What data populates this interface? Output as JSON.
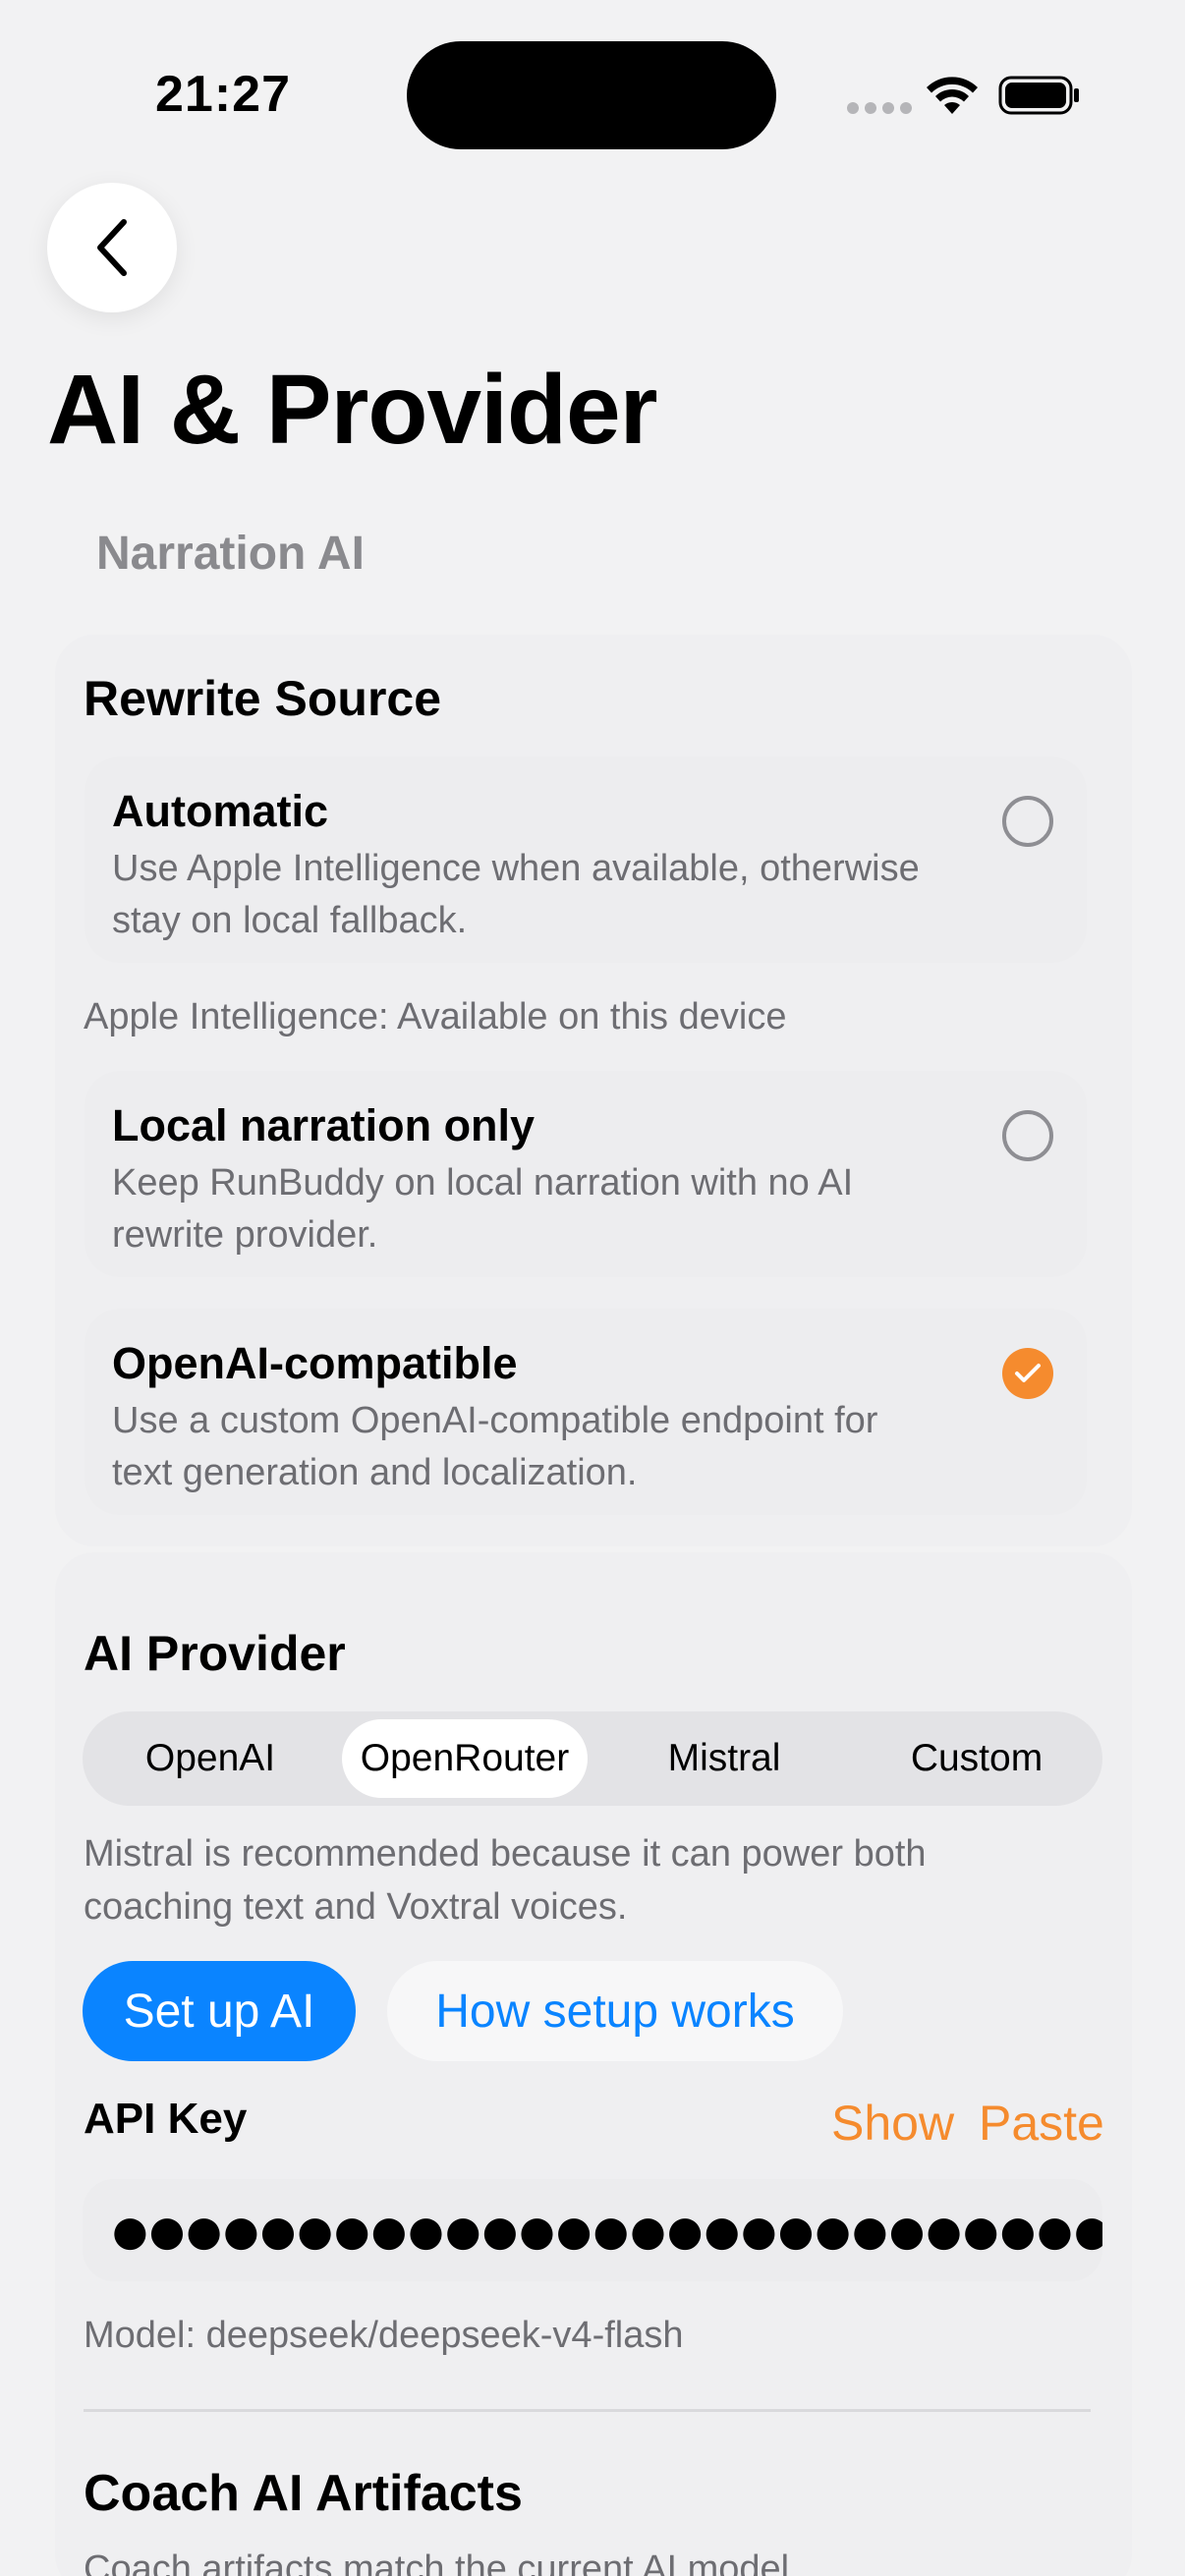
{
  "status_bar": {
    "time": "21:27"
  },
  "header": {
    "title": "AI & Provider",
    "section": "Narration AI"
  },
  "rewrite_source": {
    "title": "Rewrite Source",
    "options": [
      {
        "title": "Automatic",
        "description": "Use Apple Intelligence when available, otherwise stay on local fallback.",
        "selected": false
      },
      {
        "title": "Local narration only",
        "description": "Keep RunBuddy on local narration with no AI rewrite provider.",
        "selected": false
      },
      {
        "title": "OpenAI-compatible",
        "description": "Use a custom OpenAI-compatible endpoint for text generation and localization.",
        "selected": true
      }
    ],
    "apple_intelligence_note": "Apple Intelligence: Available on this device"
  },
  "ai_provider": {
    "title": "AI Provider",
    "segments": [
      "OpenAI",
      "OpenRouter",
      "Mistral",
      "Custom"
    ],
    "selected_segment": "OpenRouter",
    "recommendation": "Mistral is recommended because it can power both coaching text and Voxtral voices.",
    "setup_button": "Set up AI",
    "how_button": "How setup works",
    "api_key_label": "API Key",
    "show_label": "Show",
    "paste_label": "Paste",
    "api_key_value": "●●●●●●●●●●●●●●●●●●●●●●●●●●●●●●...",
    "model": "Model: deepseek/deepseek-v4-flash"
  },
  "coach": {
    "title": "Coach AI Artifacts",
    "subtitle": "Coach artifacts match the current AI model."
  },
  "colors": {
    "accent_orange": "#f58b2e",
    "accent_blue": "#0a84ff"
  }
}
